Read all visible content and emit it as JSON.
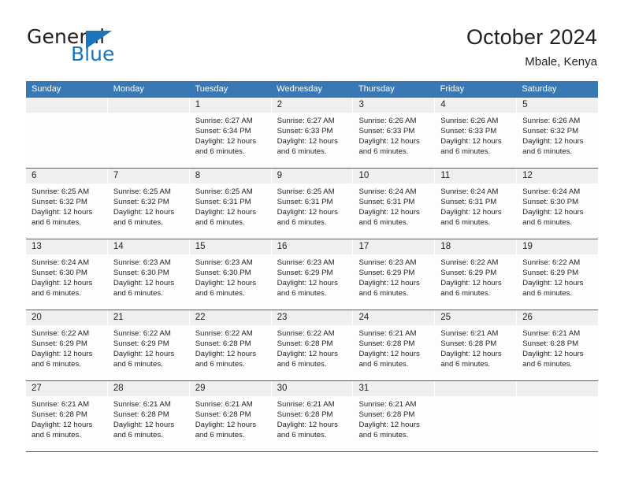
{
  "brand": {
    "name_part1": "General",
    "name_part2": "Blue",
    "logo_icon": "blue-triangle-icon",
    "accent_color": "#1b75bb"
  },
  "header": {
    "title": "October 2024",
    "subtitle": "Mbale, Kenya"
  },
  "theme": {
    "header_bar_color": "#3878b4",
    "row_divider_color": "#2f6ca8",
    "date_band_color": "#efefef",
    "cell_color": "#fdfdfd",
    "text_color": "#231f20"
  },
  "calendar": {
    "weekday_headers": [
      "Sunday",
      "Monday",
      "Tuesday",
      "Wednesday",
      "Thursday",
      "Friday",
      "Saturday"
    ],
    "weeks": [
      [
        {
          "day": "",
          "empty": true,
          "sunrise": "",
          "sunset": "",
          "daylight_line1": "",
          "daylight_line2": ""
        },
        {
          "day": "",
          "empty": true,
          "sunrise": "",
          "sunset": "",
          "daylight_line1": "",
          "daylight_line2": ""
        },
        {
          "day": "1",
          "empty": false,
          "sunrise": "Sunrise: 6:27 AM",
          "sunset": "Sunset: 6:34 PM",
          "daylight_line1": "Daylight: 12 hours",
          "daylight_line2": "and 6 minutes."
        },
        {
          "day": "2",
          "empty": false,
          "sunrise": "Sunrise: 6:27 AM",
          "sunset": "Sunset: 6:33 PM",
          "daylight_line1": "Daylight: 12 hours",
          "daylight_line2": "and 6 minutes."
        },
        {
          "day": "3",
          "empty": false,
          "sunrise": "Sunrise: 6:26 AM",
          "sunset": "Sunset: 6:33 PM",
          "daylight_line1": "Daylight: 12 hours",
          "daylight_line2": "and 6 minutes."
        },
        {
          "day": "4",
          "empty": false,
          "sunrise": "Sunrise: 6:26 AM",
          "sunset": "Sunset: 6:33 PM",
          "daylight_line1": "Daylight: 12 hours",
          "daylight_line2": "and 6 minutes."
        },
        {
          "day": "5",
          "empty": false,
          "sunrise": "Sunrise: 6:26 AM",
          "sunset": "Sunset: 6:32 PM",
          "daylight_line1": "Daylight: 12 hours",
          "daylight_line2": "and 6 minutes."
        }
      ],
      [
        {
          "day": "6",
          "empty": false,
          "sunrise": "Sunrise: 6:25 AM",
          "sunset": "Sunset: 6:32 PM",
          "daylight_line1": "Daylight: 12 hours",
          "daylight_line2": "and 6 minutes."
        },
        {
          "day": "7",
          "empty": false,
          "sunrise": "Sunrise: 6:25 AM",
          "sunset": "Sunset: 6:32 PM",
          "daylight_line1": "Daylight: 12 hours",
          "daylight_line2": "and 6 minutes."
        },
        {
          "day": "8",
          "empty": false,
          "sunrise": "Sunrise: 6:25 AM",
          "sunset": "Sunset: 6:31 PM",
          "daylight_line1": "Daylight: 12 hours",
          "daylight_line2": "and 6 minutes."
        },
        {
          "day": "9",
          "empty": false,
          "sunrise": "Sunrise: 6:25 AM",
          "sunset": "Sunset: 6:31 PM",
          "daylight_line1": "Daylight: 12 hours",
          "daylight_line2": "and 6 minutes."
        },
        {
          "day": "10",
          "empty": false,
          "sunrise": "Sunrise: 6:24 AM",
          "sunset": "Sunset: 6:31 PM",
          "daylight_line1": "Daylight: 12 hours",
          "daylight_line2": "and 6 minutes."
        },
        {
          "day": "11",
          "empty": false,
          "sunrise": "Sunrise: 6:24 AM",
          "sunset": "Sunset: 6:31 PM",
          "daylight_line1": "Daylight: 12 hours",
          "daylight_line2": "and 6 minutes."
        },
        {
          "day": "12",
          "empty": false,
          "sunrise": "Sunrise: 6:24 AM",
          "sunset": "Sunset: 6:30 PM",
          "daylight_line1": "Daylight: 12 hours",
          "daylight_line2": "and 6 minutes."
        }
      ],
      [
        {
          "day": "13",
          "empty": false,
          "sunrise": "Sunrise: 6:24 AM",
          "sunset": "Sunset: 6:30 PM",
          "daylight_line1": "Daylight: 12 hours",
          "daylight_line2": "and 6 minutes."
        },
        {
          "day": "14",
          "empty": false,
          "sunrise": "Sunrise: 6:23 AM",
          "sunset": "Sunset: 6:30 PM",
          "daylight_line1": "Daylight: 12 hours",
          "daylight_line2": "and 6 minutes."
        },
        {
          "day": "15",
          "empty": false,
          "sunrise": "Sunrise: 6:23 AM",
          "sunset": "Sunset: 6:30 PM",
          "daylight_line1": "Daylight: 12 hours",
          "daylight_line2": "and 6 minutes."
        },
        {
          "day": "16",
          "empty": false,
          "sunrise": "Sunrise: 6:23 AM",
          "sunset": "Sunset: 6:29 PM",
          "daylight_line1": "Daylight: 12 hours",
          "daylight_line2": "and 6 minutes."
        },
        {
          "day": "17",
          "empty": false,
          "sunrise": "Sunrise: 6:23 AM",
          "sunset": "Sunset: 6:29 PM",
          "daylight_line1": "Daylight: 12 hours",
          "daylight_line2": "and 6 minutes."
        },
        {
          "day": "18",
          "empty": false,
          "sunrise": "Sunrise: 6:22 AM",
          "sunset": "Sunset: 6:29 PM",
          "daylight_line1": "Daylight: 12 hours",
          "daylight_line2": "and 6 minutes."
        },
        {
          "day": "19",
          "empty": false,
          "sunrise": "Sunrise: 6:22 AM",
          "sunset": "Sunset: 6:29 PM",
          "daylight_line1": "Daylight: 12 hours",
          "daylight_line2": "and 6 minutes."
        }
      ],
      [
        {
          "day": "20",
          "empty": false,
          "sunrise": "Sunrise: 6:22 AM",
          "sunset": "Sunset: 6:29 PM",
          "daylight_line1": "Daylight: 12 hours",
          "daylight_line2": "and 6 minutes."
        },
        {
          "day": "21",
          "empty": false,
          "sunrise": "Sunrise: 6:22 AM",
          "sunset": "Sunset: 6:29 PM",
          "daylight_line1": "Daylight: 12 hours",
          "daylight_line2": "and 6 minutes."
        },
        {
          "day": "22",
          "empty": false,
          "sunrise": "Sunrise: 6:22 AM",
          "sunset": "Sunset: 6:28 PM",
          "daylight_line1": "Daylight: 12 hours",
          "daylight_line2": "and 6 minutes."
        },
        {
          "day": "23",
          "empty": false,
          "sunrise": "Sunrise: 6:22 AM",
          "sunset": "Sunset: 6:28 PM",
          "daylight_line1": "Daylight: 12 hours",
          "daylight_line2": "and 6 minutes."
        },
        {
          "day": "24",
          "empty": false,
          "sunrise": "Sunrise: 6:21 AM",
          "sunset": "Sunset: 6:28 PM",
          "daylight_line1": "Daylight: 12 hours",
          "daylight_line2": "and 6 minutes."
        },
        {
          "day": "25",
          "empty": false,
          "sunrise": "Sunrise: 6:21 AM",
          "sunset": "Sunset: 6:28 PM",
          "daylight_line1": "Daylight: 12 hours",
          "daylight_line2": "and 6 minutes."
        },
        {
          "day": "26",
          "empty": false,
          "sunrise": "Sunrise: 6:21 AM",
          "sunset": "Sunset: 6:28 PM",
          "daylight_line1": "Daylight: 12 hours",
          "daylight_line2": "and 6 minutes."
        }
      ],
      [
        {
          "day": "27",
          "empty": false,
          "sunrise": "Sunrise: 6:21 AM",
          "sunset": "Sunset: 6:28 PM",
          "daylight_line1": "Daylight: 12 hours",
          "daylight_line2": "and 6 minutes."
        },
        {
          "day": "28",
          "empty": false,
          "sunrise": "Sunrise: 6:21 AM",
          "sunset": "Sunset: 6:28 PM",
          "daylight_line1": "Daylight: 12 hours",
          "daylight_line2": "and 6 minutes."
        },
        {
          "day": "29",
          "empty": false,
          "sunrise": "Sunrise: 6:21 AM",
          "sunset": "Sunset: 6:28 PM",
          "daylight_line1": "Daylight: 12 hours",
          "daylight_line2": "and 6 minutes."
        },
        {
          "day": "30",
          "empty": false,
          "sunrise": "Sunrise: 6:21 AM",
          "sunset": "Sunset: 6:28 PM",
          "daylight_line1": "Daylight: 12 hours",
          "daylight_line2": "and 6 minutes."
        },
        {
          "day": "31",
          "empty": false,
          "sunrise": "Sunrise: 6:21 AM",
          "sunset": "Sunset: 6:28 PM",
          "daylight_line1": "Daylight: 12 hours",
          "daylight_line2": "and 6 minutes."
        },
        {
          "day": "",
          "empty": true,
          "sunrise": "",
          "sunset": "",
          "daylight_line1": "",
          "daylight_line2": ""
        },
        {
          "day": "",
          "empty": true,
          "sunrise": "",
          "sunset": "",
          "daylight_line1": "",
          "daylight_line2": ""
        }
      ]
    ]
  }
}
